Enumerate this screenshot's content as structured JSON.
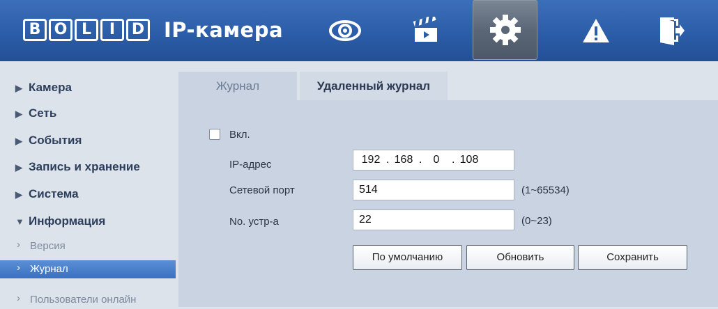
{
  "header": {
    "logo_text": "BOLID",
    "logo_letters": [
      "B",
      "O",
      "L",
      "I",
      "D"
    ],
    "title": "IP-камера",
    "nav": [
      {
        "icon": "eye-icon",
        "label": "live-view"
      },
      {
        "icon": "clapperboard-icon",
        "label": "playback"
      },
      {
        "icon": "gear-icon",
        "label": "settings",
        "active": true
      },
      {
        "icon": "warning-icon",
        "label": "alarm"
      },
      {
        "icon": "logout-icon",
        "label": "exit"
      }
    ]
  },
  "sidebar": {
    "items": [
      {
        "label": "Камера",
        "expanded": false
      },
      {
        "label": "Сеть",
        "expanded": false
      },
      {
        "label": "События",
        "expanded": false
      },
      {
        "label": "Запись и хранение",
        "expanded": false
      },
      {
        "label": "Система",
        "expanded": false
      },
      {
        "label": "Информация",
        "expanded": true
      }
    ],
    "subitems": [
      {
        "label": "Версия",
        "active": false
      },
      {
        "label": "Журнал",
        "active": true
      },
      {
        "label": "Пользователи онлайн",
        "active": false
      }
    ],
    "tri_closed": "▶",
    "tri_open": "▼",
    "chev": "›"
  },
  "tabs": [
    {
      "label": "Журнал",
      "active": false
    },
    {
      "label": "Удаленный журнал",
      "active": true
    }
  ],
  "form": {
    "enable_label": "Вкл.",
    "enable_checked": false,
    "ip_label": "IP-адрес",
    "ip": [
      "192",
      "168",
      "0",
      "108"
    ],
    "port_label": "Сетевой порт",
    "port_value": "514",
    "port_range": "(1~65534)",
    "device_label": "No. устр-а",
    "device_value": "22",
    "device_range": "(0~23)"
  },
  "buttons": {
    "default": "По умолчанию",
    "refresh": "Обновить",
    "save": "Сохранить"
  },
  "colors": {
    "header": "#2c5da8",
    "active_item": "#3a70c0",
    "panel": "#c9d3e1"
  }
}
